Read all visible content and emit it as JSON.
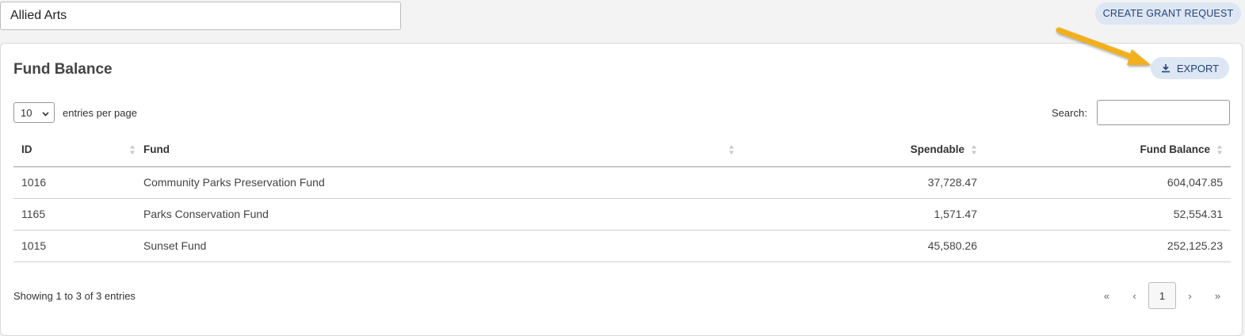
{
  "org_selector": {
    "value": "Allied Arts"
  },
  "actions": {
    "create_grant_label": "CREATE GRANT REQUEST",
    "export_label": "EXPORT"
  },
  "card": {
    "title": "Fund Balance"
  },
  "length_menu": {
    "selected": "10",
    "label": "entries per page"
  },
  "search": {
    "label": "Search:",
    "value": ""
  },
  "table": {
    "headers": {
      "id": "ID",
      "fund": "Fund",
      "spendable": "Spendable",
      "balance": "Fund Balance"
    },
    "rows": [
      {
        "id": "1016",
        "fund": "Community Parks Preservation Fund",
        "spendable": "37,728.47",
        "balance": "604,047.85"
      },
      {
        "id": "1165",
        "fund": "Parks Conservation Fund",
        "spendable": "1,571.47",
        "balance": "52,554.31"
      },
      {
        "id": "1015",
        "fund": "Sunset Fund",
        "spendable": "45,580.26",
        "balance": "252,125.23"
      }
    ]
  },
  "footer": {
    "info": "Showing 1 to 3 of 3 entries"
  },
  "pagination": {
    "first": "«",
    "prev": "‹",
    "current": "1",
    "next": "›",
    "last": "»"
  },
  "colors": {
    "accent_bg": "#dde6f3",
    "accent_text": "#24427a",
    "annotation_arrow": "#f2b01e"
  },
  "icons": {
    "export": "download-icon",
    "sort": "sort-icon",
    "dropdown": "chevron-down-icon"
  }
}
